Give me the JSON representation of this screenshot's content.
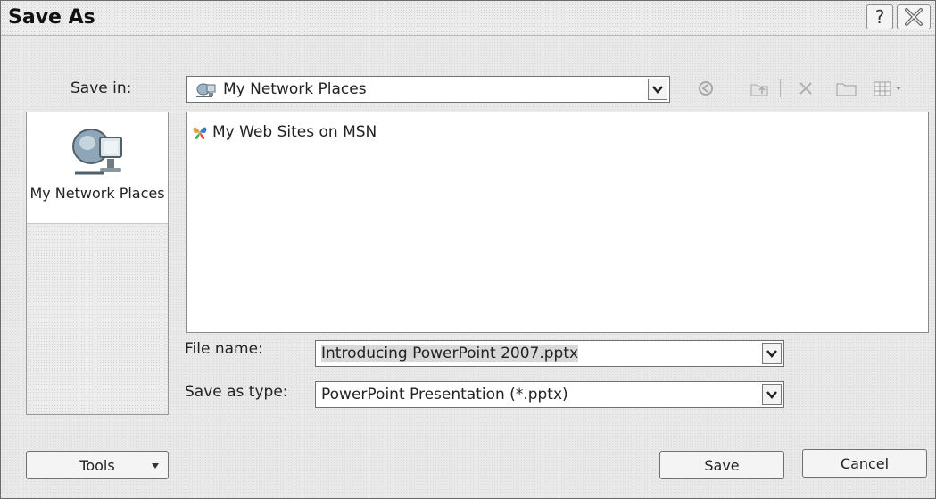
{
  "window": {
    "title": "Save As",
    "help_label": "?"
  },
  "save_in": {
    "label": "Save in:",
    "value": "My Network Places"
  },
  "toolbar": {
    "icons": [
      "back-icon",
      "up-folder-icon",
      "delete-icon",
      "new-folder-icon",
      "views-icon"
    ]
  },
  "places_bar": {
    "items": [
      {
        "label": "My Network Places",
        "icon": "network-places-icon"
      }
    ]
  },
  "file_list": {
    "items": [
      {
        "label": "My Web Sites on MSN",
        "icon": "msn-butterfly-icon"
      }
    ]
  },
  "file_name": {
    "label": "File name:",
    "value": "Introducing PowerPoint 2007.pptx"
  },
  "save_as_type": {
    "label": "Save as type:",
    "value": "PowerPoint Presentation (*.pptx)"
  },
  "buttons": {
    "tools": "Tools",
    "save": "Save",
    "cancel": "Cancel"
  }
}
